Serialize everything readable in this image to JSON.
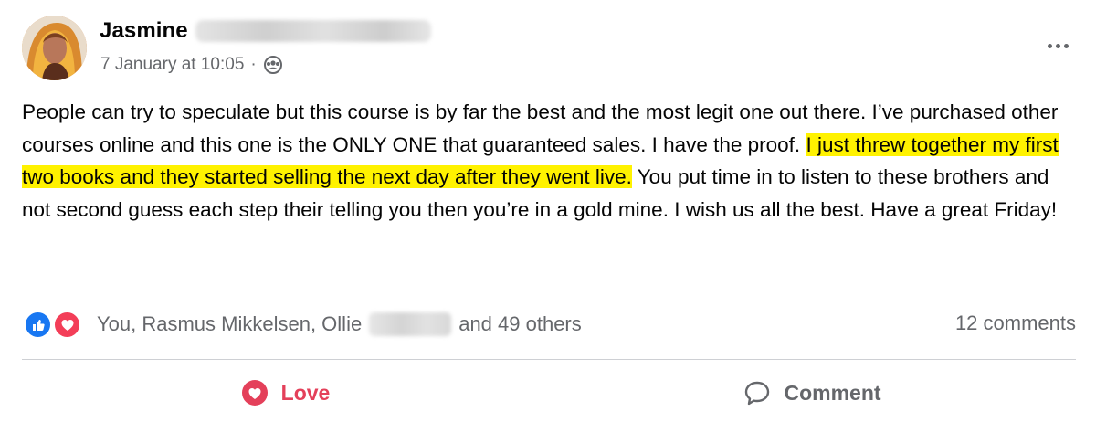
{
  "post": {
    "author": {
      "name": "Jasmine"
    },
    "meta": {
      "timestamp": "7 January at 10:05",
      "separator": "·"
    },
    "body": {
      "text_before": "People can try to speculate but this course is by far the best and the most legit one out there. I’ve purchased other courses online and this one is the ONLY ONE that guaranteed sales. I have the proof. ",
      "highlighted": "I just threw together my first two books and they started selling the next day after they went live.",
      "text_after": " You put time in to listen to these brothers and not second guess each step their telling you then you’re in a gold mine. I wish us all the best. Have a great Friday!"
    },
    "reactions": {
      "types": [
        "like",
        "love"
      ],
      "names_prefix": "You, Rasmus Mikkelsen, Ollie",
      "names_suffix": "and 49 others"
    },
    "comments_count": "12 comments",
    "actions": {
      "love_label": "Love",
      "comment_label": "Comment"
    },
    "colors": {
      "highlight": "#fff200",
      "love": "#e4405a",
      "like": "#1877f2",
      "muted": "#65676b"
    },
    "icons": [
      "more-options-icon",
      "audience-icon",
      "like-reaction-icon",
      "love-reaction-icon",
      "love-icon",
      "comment-icon"
    ]
  }
}
